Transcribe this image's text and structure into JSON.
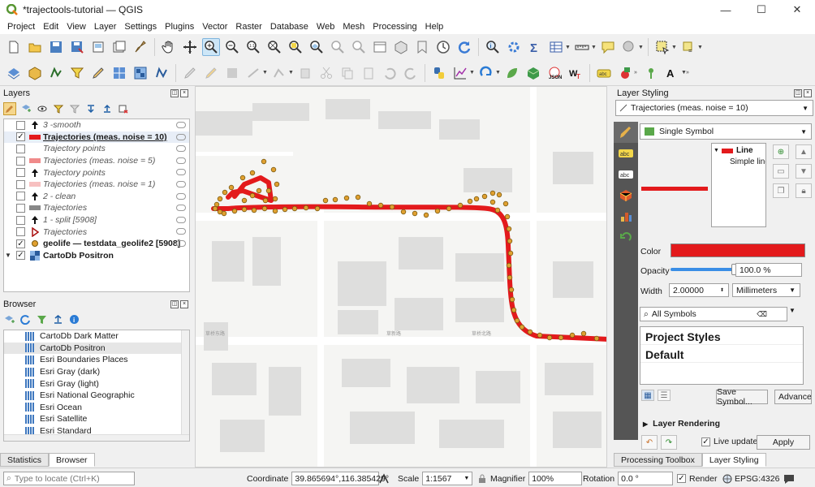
{
  "window": {
    "title": "*trajectools-tutorial — QGIS",
    "minimize": "—",
    "maximize": "☐",
    "close": "✕"
  },
  "menu": [
    "Project",
    "Edit",
    "View",
    "Layer",
    "Settings",
    "Plugins",
    "Vector",
    "Raster",
    "Database",
    "Web",
    "Mesh",
    "Processing",
    "Help"
  ],
  "layers_panel": {
    "title": "Layers",
    "items": [
      {
        "name": "3 -smooth",
        "checked": false,
        "style": "italic",
        "symbol": "arrow"
      },
      {
        "name": "Trajectories (meas. noise = 10)",
        "checked": true,
        "style": "sel",
        "symbol": "red-line"
      },
      {
        "name": "Trajectory points",
        "checked": false,
        "style": "italic",
        "symbol": "none"
      },
      {
        "name": "Trajectories (meas. noise = 5)",
        "checked": false,
        "style": "italic",
        "symbol": "pink-line"
      },
      {
        "name": "Trajectory points",
        "checked": false,
        "style": "italic",
        "symbol": "arrow"
      },
      {
        "name": "Trajectories (meas. noise = 1)",
        "checked": false,
        "style": "italic",
        "symbol": "lightpink-line"
      },
      {
        "name": "2 - clean",
        "checked": false,
        "style": "italic",
        "symbol": "arrow"
      },
      {
        "name": "Trajectories",
        "checked": false,
        "style": "italic",
        "symbol": "gray-line"
      },
      {
        "name": "1 - split [5908]",
        "checked": false,
        "style": "italic",
        "symbol": "arrow"
      },
      {
        "name": "Trajectories",
        "checked": false,
        "style": "italic",
        "symbol": "trajectory-icon"
      },
      {
        "name": "geolife — testdata_geolife2 [5908]",
        "checked": true,
        "style": "bold",
        "symbol": "dot"
      },
      {
        "name": "CartoDb Positron",
        "checked": true,
        "style": "bold",
        "symbol": "raster",
        "expanded": true
      }
    ]
  },
  "browser_panel": {
    "title": "Browser",
    "items": [
      "CartoDb Dark Matter",
      "CartoDb Positron",
      "Esri Boundaries Places",
      "Esri Gray (dark)",
      "Esri Gray (light)",
      "Esri National Geographic",
      "Esri Ocean",
      "Esri Satellite",
      "Esri Standard",
      "Esri Topo"
    ],
    "selected_index": 1
  },
  "left_tabs": {
    "statistics": "Statistics",
    "browser": "Browser"
  },
  "styling_panel": {
    "title": "Layer Styling",
    "layer": "Trajectories (meas. noise = 10)",
    "renderer": "Single Symbol",
    "tree": {
      "line": "Line",
      "simple": "Simple line"
    },
    "color_label": "Color",
    "color_value": "#e31a1c",
    "opacity_label": "Opacity",
    "opacity_value": "100.0 %",
    "opacity_fraction": 1.0,
    "width_label": "Width",
    "width_value": "2.00000",
    "width_unit": "Millimeters",
    "symbol_search": "All Symbols",
    "styles": [
      "Project Styles",
      "Default"
    ],
    "save_symbol": "Save Symbol...",
    "advanced": "Advanced",
    "layer_rendering": "Layer Rendering",
    "live_update": "Live update",
    "apply": "Apply"
  },
  "right_tabs": {
    "processing": "Processing Toolbox",
    "styling": "Layer Styling"
  },
  "status": {
    "locate_placeholder": "Type to locate (Ctrl+K)",
    "coordinate_label": "Coordinate",
    "coordinate_value": "39.865694°,116.385429°",
    "scale_label": "Scale",
    "scale_value": "1:1567",
    "magnifier_label": "Magnifier",
    "magnifier_value": "100%",
    "rotation_label": "Rotation",
    "rotation_value": "0.0 °",
    "render_label": "Render",
    "crs": "EPSG:4326"
  },
  "map_labels": [
    "草桥东路",
    "草新路",
    "草桥北路"
  ],
  "colors": {
    "trajectory": "#e31a1c",
    "point": "#e0a030",
    "point_stroke": "#7a5a10"
  }
}
